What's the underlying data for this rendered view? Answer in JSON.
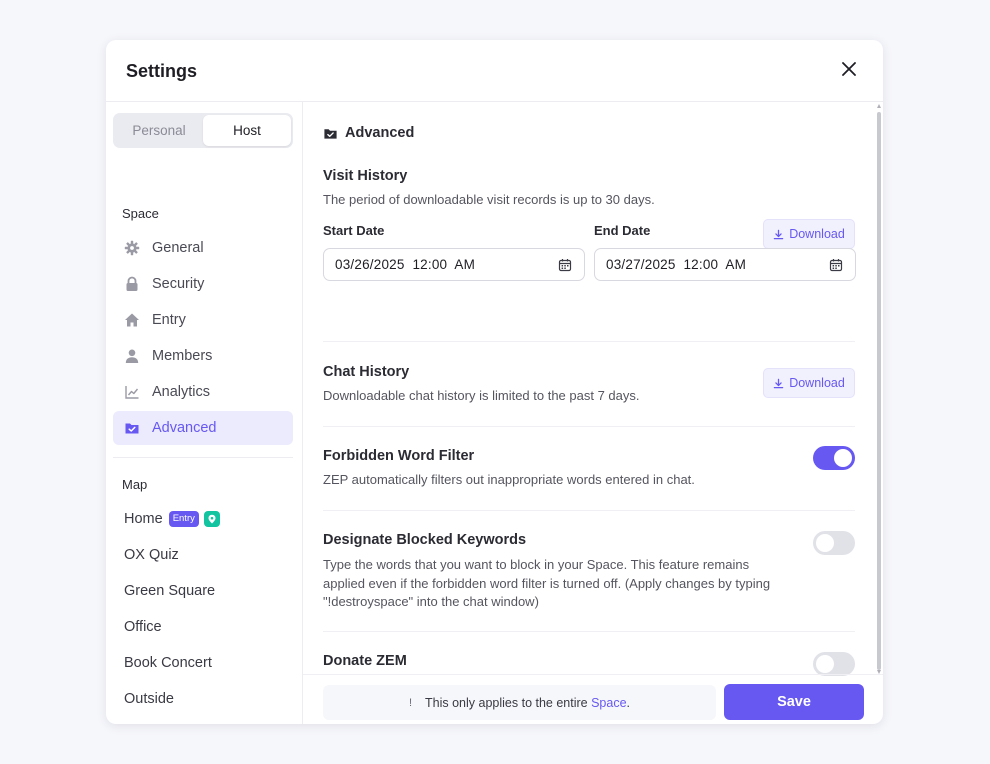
{
  "modal": {
    "title": "Settings"
  },
  "tabs": [
    {
      "label": "Personal",
      "active": false
    },
    {
      "label": "Host",
      "active": true
    }
  ],
  "sidebar": {
    "space_label": "Space",
    "items": [
      {
        "label": "General",
        "icon": "gear-icon"
      },
      {
        "label": "Security",
        "icon": "lock-icon"
      },
      {
        "label": "Entry",
        "icon": "home-icon"
      },
      {
        "label": "Members",
        "icon": "user-icon"
      },
      {
        "label": "Analytics",
        "icon": "chart-icon"
      },
      {
        "label": "Advanced",
        "icon": "folder-check-icon",
        "active": true
      }
    ],
    "map_label": "Map",
    "maps": [
      {
        "label": "Home",
        "badge": "Entry",
        "pin": true
      },
      {
        "label": "OX Quiz"
      },
      {
        "label": "Green Square"
      },
      {
        "label": "Office"
      },
      {
        "label": "Book Concert"
      },
      {
        "label": "Outside"
      }
    ]
  },
  "content": {
    "section_title": "Advanced",
    "visit_history": {
      "title": "Visit History",
      "desc": "The period of downloadable visit records is up to 30 days.",
      "download_label": "Download",
      "start_label": "Start Date",
      "start_value": "03/26/2025  12:00  AM",
      "end_label": "End Date",
      "end_value": "03/27/2025  12:00  AM"
    },
    "chat_history": {
      "title": "Chat History",
      "desc": "Downloadable chat history is limited to the past 7 days.",
      "download_label": "Download"
    },
    "forbidden_filter": {
      "title": "Forbidden Word Filter",
      "desc": "ZEP automatically filters out inappropriate words entered in chat.",
      "enabled": true
    },
    "blocked_keywords": {
      "title": "Designate Blocked Keywords",
      "desc_line1": "Type the words that you want to block in your Space. This feature remains",
      "desc_line2": "applied even if the forbidden word filter is turned off. (Apply changes by typing",
      "desc_line3": "\"!destroyspace\" into the chat window)",
      "enabled": false
    },
    "donate": {
      "title": "Donate ZEM",
      "enabled": false
    }
  },
  "footer": {
    "notice_mark": "!",
    "notice_text": "This only applies to the entire ",
    "notice_link": "Space",
    "notice_end": ".",
    "save_label": "Save"
  },
  "colors": {
    "accent": "#6758f2",
    "toggle_off": "#e1e2e8",
    "pin": "#12c4a0"
  }
}
